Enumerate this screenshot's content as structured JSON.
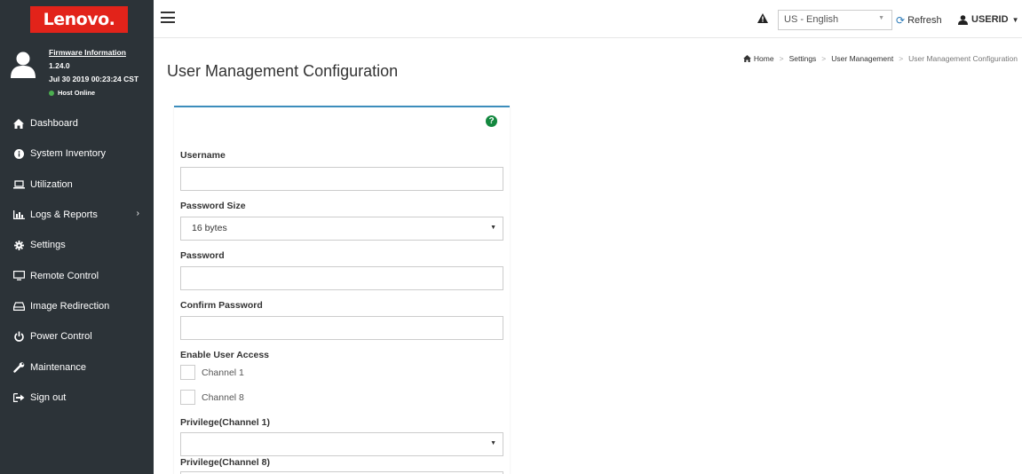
{
  "brand": {
    "logo_text": "Lenovo.",
    "color": "#e2231a"
  },
  "firmware": {
    "title": "Firmware Information",
    "version": "1.24.0",
    "date": "Jul 30 2019 00:23:24 CST",
    "status": "Host Online"
  },
  "sidebar": {
    "items": [
      {
        "label": "Dashboard",
        "icon": "home-icon"
      },
      {
        "label": "System Inventory",
        "icon": "info-icon"
      },
      {
        "label": "Utilization",
        "icon": "laptop-icon"
      },
      {
        "label": "Logs & Reports",
        "icon": "bar-chart-icon",
        "has_submenu": true
      },
      {
        "label": "Settings",
        "icon": "gear-icon"
      },
      {
        "label": "Remote Control",
        "icon": "monitor-icon"
      },
      {
        "label": "Image Redirection",
        "icon": "disk-icon"
      },
      {
        "label": "Power Control",
        "icon": "power-icon"
      },
      {
        "label": "Maintenance",
        "icon": "wrench-icon"
      },
      {
        "label": "Sign out",
        "icon": "sign-out-icon"
      }
    ]
  },
  "header": {
    "language": "US - English",
    "refresh_label": "Refresh",
    "user_label": "USERID"
  },
  "breadcrumb": {
    "home": "Home",
    "settings": "Settings",
    "user_management": "User Management",
    "current": "User Management Configuration"
  },
  "page": {
    "title": "User Management Configuration"
  },
  "form": {
    "username_label": "Username",
    "username_value": "",
    "password_size_label": "Password Size",
    "password_size_value": "16 bytes",
    "password_label": "Password",
    "password_value": "",
    "confirm_password_label": "Confirm Password",
    "confirm_password_value": "",
    "enable_access_label": "Enable User Access",
    "channel1_label": "Channel 1",
    "channel8_label": "Channel 8",
    "privilege1_label": "Privilege(Channel 1)",
    "privilege1_value": "",
    "privilege8_label": "Privilege(Channel 8)"
  }
}
